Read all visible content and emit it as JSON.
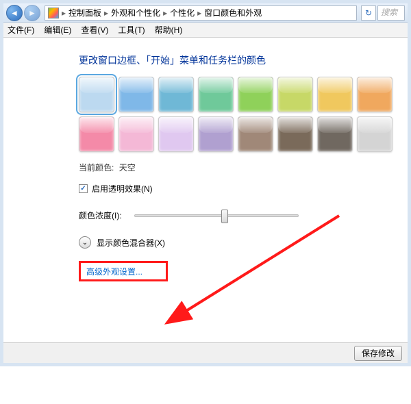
{
  "breadcrumb": {
    "items": [
      "控制面板",
      "外观和个性化",
      "个性化",
      "窗口颜色和外观"
    ]
  },
  "search": {
    "placeholder": "搜索"
  },
  "menubar": {
    "file": "文件(F)",
    "edit": "编辑(E)",
    "view": "查看(V)",
    "tools": "工具(T)",
    "help": "帮助(H)"
  },
  "title": "更改窗口边框、「开始」菜单和任务栏的颜色",
  "colors": [
    {
      "hex": "#bcd9f0",
      "selected": true
    },
    {
      "hex": "#7fb8e8"
    },
    {
      "hex": "#6fb8d6"
    },
    {
      "hex": "#6fc99a"
    },
    {
      "hex": "#8fd15a"
    },
    {
      "hex": "#c7d867"
    },
    {
      "hex": "#f0c85e"
    },
    {
      "hex": "#f0a85e"
    },
    {
      "hex": "#f48aa8"
    },
    {
      "hex": "#f4b8d6"
    },
    {
      "hex": "#e0c8f0"
    },
    {
      "hex": "#b0a0d0"
    },
    {
      "hex": "#a08878"
    },
    {
      "hex": "#7a6a5a"
    },
    {
      "hex": "#706860"
    },
    {
      "hex": "#d4d4d4"
    }
  ],
  "current": {
    "label": "当前颜色:",
    "value": "天空"
  },
  "transparency": {
    "label": "启用透明效果(N)",
    "checked": true
  },
  "intensity": {
    "label": "颜色浓度(I):",
    "value": 55
  },
  "mixer": {
    "label": "显示颜色混合器(X)"
  },
  "advanced": {
    "label": "高级外观设置..."
  },
  "footer": {
    "save": "保存修改"
  }
}
